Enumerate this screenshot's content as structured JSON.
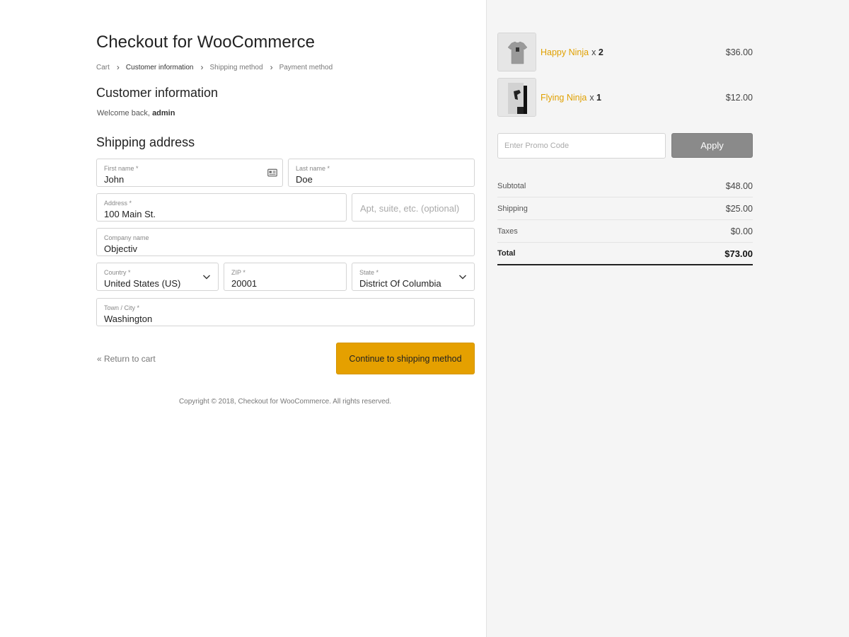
{
  "header": {
    "title": "Checkout for WooCommerce"
  },
  "breadcrumb": {
    "items": [
      "Cart",
      "Customer information",
      "Shipping method",
      "Payment method"
    ],
    "active": "Customer information"
  },
  "customer": {
    "heading": "Customer information",
    "welcome_prefix": "Welcome back, ",
    "username": "admin"
  },
  "shipping": {
    "heading": "Shipping address",
    "first_name": {
      "label": "First name *",
      "value": "John"
    },
    "last_name": {
      "label": "Last name *",
      "value": "Doe"
    },
    "address": {
      "label": "Address *",
      "value": "100 Main St."
    },
    "apt": {
      "placeholder": "Apt, suite, etc. (optional)"
    },
    "company": {
      "label": "Company name",
      "value": "Objectiv"
    },
    "country": {
      "label": "Country *",
      "value": "United States (US)"
    },
    "zip": {
      "label": "ZIP *",
      "value": "20001"
    },
    "state": {
      "label": "State *",
      "value": "District Of Columbia"
    },
    "city": {
      "label": "Town / City *",
      "value": "Washington"
    }
  },
  "actions": {
    "return_label": "« Return to cart",
    "continue_label": "Continue to shipping method"
  },
  "footer": {
    "copyright": "Copyright © 2018, Checkout for WooCommerce. All rights reserved."
  },
  "cart": {
    "items": [
      {
        "name": "Happy Ninja",
        "qty_prefix": "x ",
        "qty": "2",
        "price": "$36.00",
        "thumb_icon": "tshirt-icon"
      },
      {
        "name": "Flying Ninja",
        "qty_prefix": "x ",
        "qty": "1",
        "price": "$12.00",
        "thumb_icon": "poster-icon"
      }
    ]
  },
  "promo": {
    "placeholder": "Enter Promo Code",
    "button_label": "Apply"
  },
  "totals": {
    "subtotal": {
      "label": "Subtotal",
      "amount": "$48.00"
    },
    "shipping": {
      "label": "Shipping",
      "amount": "$25.00"
    },
    "taxes": {
      "label": "Taxes",
      "amount": "$0.00"
    },
    "total": {
      "label": "Total",
      "amount": "$73.00"
    }
  },
  "colors": {
    "accent": "#e5a000",
    "product_link": "#e0a000",
    "apply_button": "#8a8a8a",
    "sidebar_bg": "#f5f5f5"
  }
}
